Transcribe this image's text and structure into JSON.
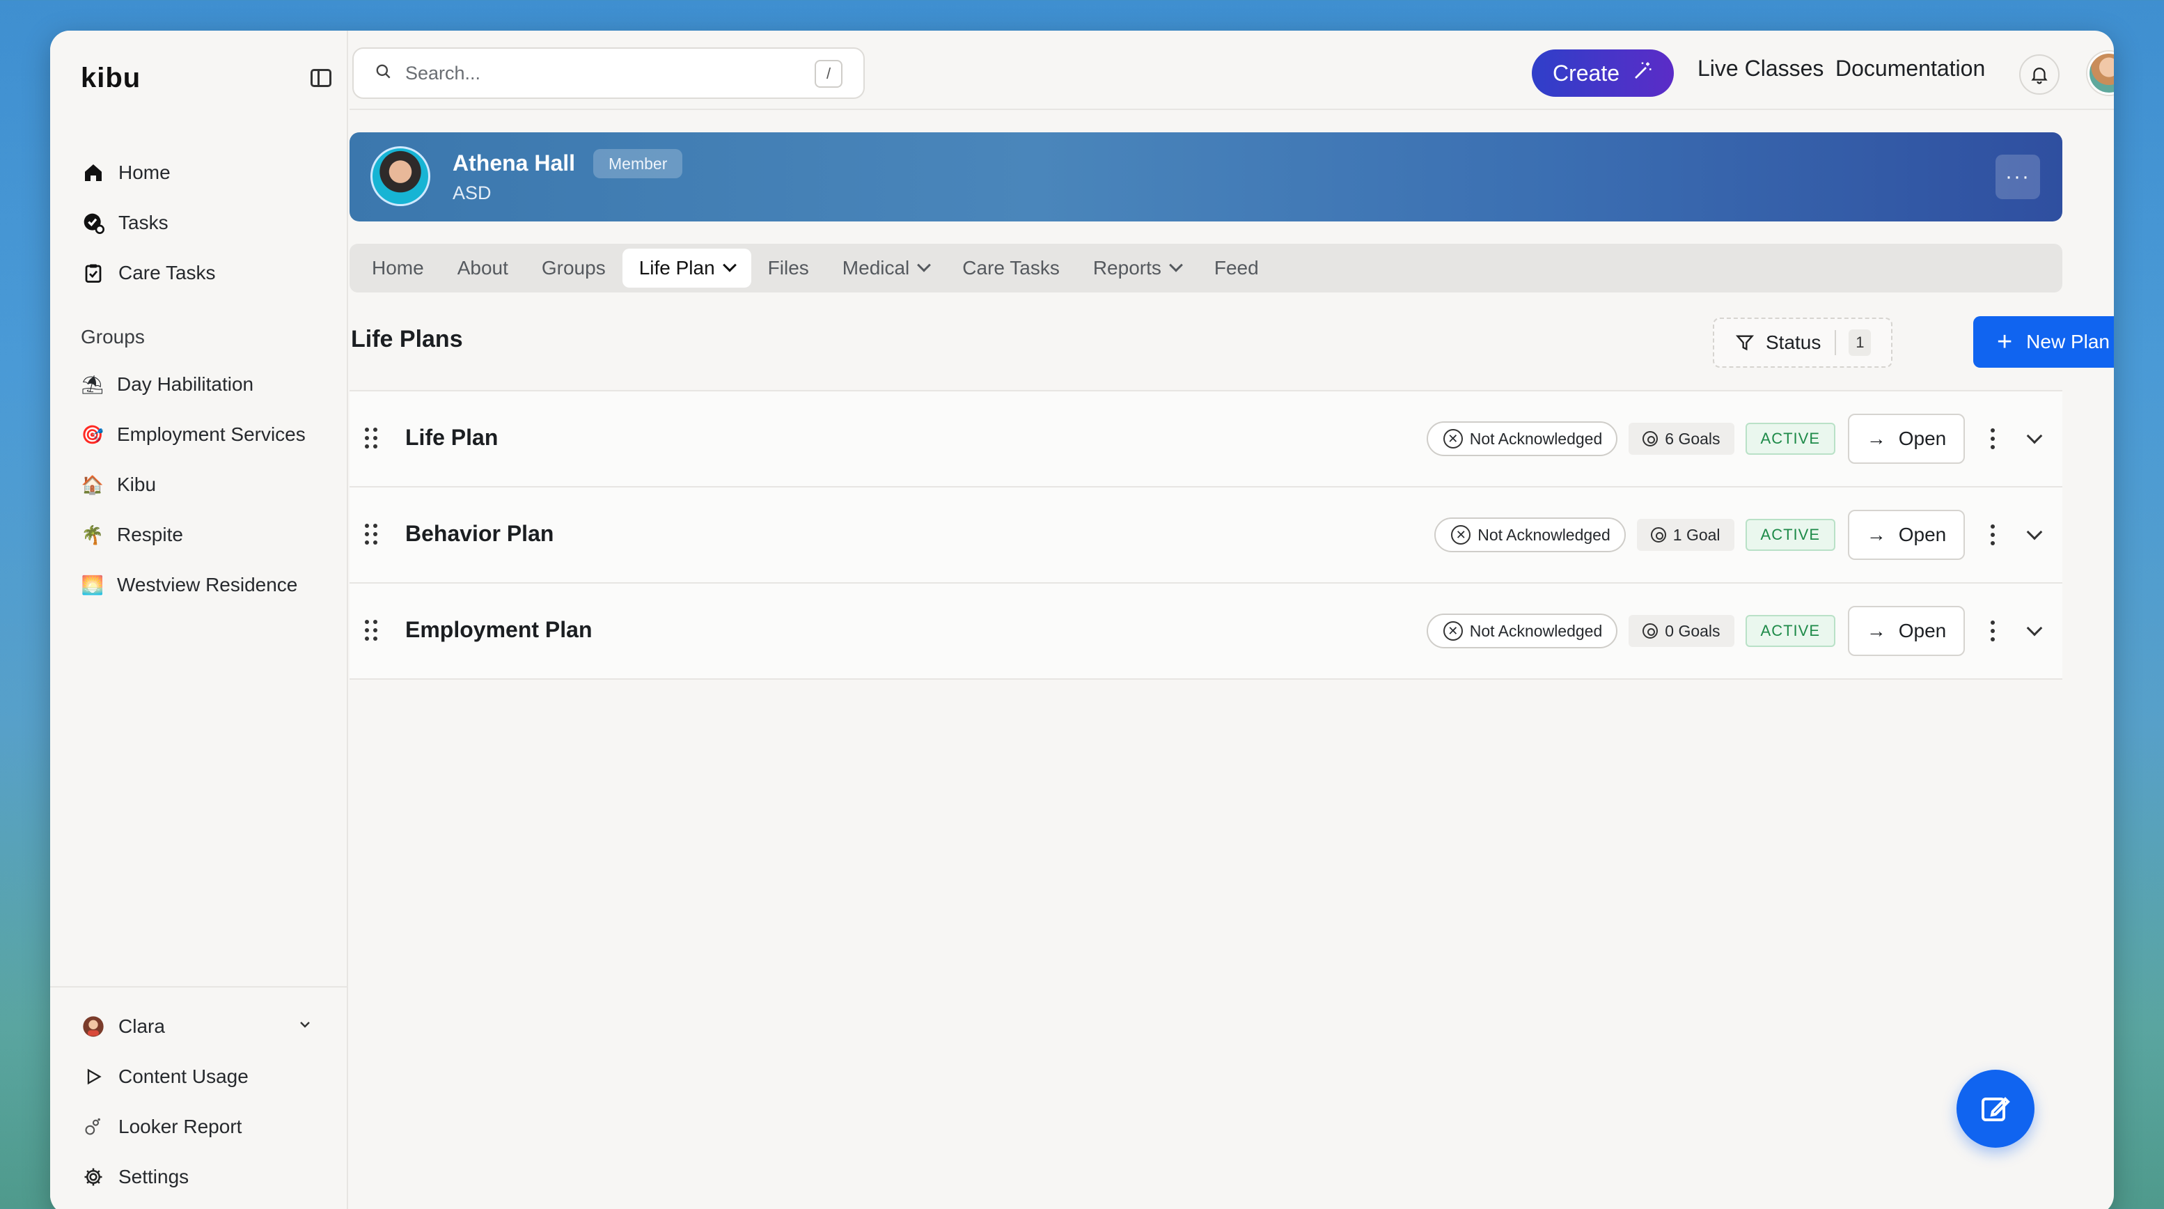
{
  "app": {
    "logo": "kibu"
  },
  "sidebar": {
    "nav": [
      {
        "label": "Home",
        "icon": "home-icon"
      },
      {
        "label": "Tasks",
        "icon": "tasks-icon"
      },
      {
        "label": "Care Tasks",
        "icon": "clipboard-icon"
      }
    ],
    "groups_label": "Groups",
    "groups": [
      {
        "label": "Day Habilitation",
        "emoji": "⛱"
      },
      {
        "label": "Employment Services",
        "emoji": "🎯"
      },
      {
        "label": "Kibu",
        "emoji": "🏠"
      },
      {
        "label": "Respite",
        "emoji": "🌴"
      },
      {
        "label": "Westview Residence",
        "emoji": "🌅"
      }
    ],
    "bottom": [
      {
        "label": "Clara",
        "icon": "user-avatar"
      },
      {
        "label": "Content Usage",
        "icon": "play-icon"
      },
      {
        "label": "Looker Report",
        "icon": "looker-icon"
      },
      {
        "label": "Settings",
        "icon": "gear-icon"
      }
    ]
  },
  "topbar": {
    "search_placeholder": "Search...",
    "search_shortcut": "/",
    "create_label": "Create",
    "live_classes": "Live Classes",
    "documentation": "Documentation"
  },
  "profile": {
    "name": "Athena Hall",
    "role_badge": "Member",
    "subtitle": "ASD",
    "more": "···"
  },
  "tabs": [
    {
      "label": "Home",
      "dropdown": false
    },
    {
      "label": "About",
      "dropdown": false
    },
    {
      "label": "Groups",
      "dropdown": false
    },
    {
      "label": "Life Plan",
      "dropdown": true,
      "active": true
    },
    {
      "label": "Files",
      "dropdown": false
    },
    {
      "label": "Medical",
      "dropdown": true
    },
    {
      "label": "Care Tasks",
      "dropdown": false
    },
    {
      "label": "Reports",
      "dropdown": true
    },
    {
      "label": "Feed",
      "dropdown": false
    }
  ],
  "life_plans": {
    "title": "Life Plans",
    "status_filter": {
      "label": "Status",
      "count": "1"
    },
    "new_plan_label": "New Plan",
    "rows": [
      {
        "name": "Life Plan",
        "ack": "Not Acknowledged",
        "goals": "6 Goals",
        "status": "ACTIVE",
        "open": "Open"
      },
      {
        "name": "Behavior Plan",
        "ack": "Not Acknowledged",
        "goals": "1 Goal",
        "status": "ACTIVE",
        "open": "Open"
      },
      {
        "name": "Employment Plan",
        "ack": "Not Acknowledged",
        "goals": "0 Goals",
        "status": "ACTIVE",
        "open": "Open"
      }
    ]
  },
  "colors": {
    "primary": "#1064f0",
    "active_green": "#1d8a48",
    "banner": "#3b77ad"
  }
}
